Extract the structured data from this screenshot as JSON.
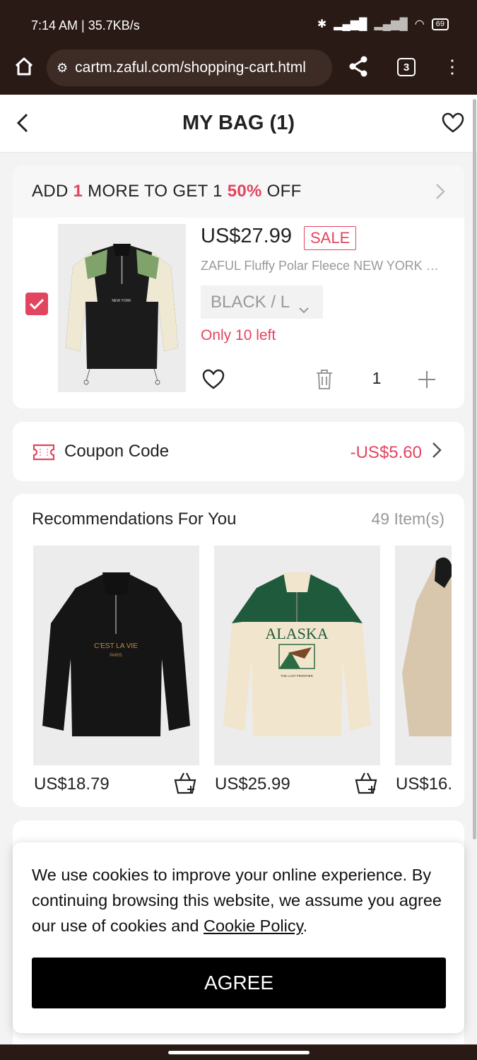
{
  "status_bar": {
    "time": "7:14 AM | 35.7KB/s",
    "battery": "69"
  },
  "browser": {
    "url": "cartm.zaful.com/shopping-cart.html",
    "tab_count": "3"
  },
  "header": {
    "title": "MY BAG (1)"
  },
  "promo": {
    "prefix": "ADD ",
    "count": "1",
    "middle": " MORE TO GET 1 ",
    "discount": "50%",
    "suffix": " OFF"
  },
  "cart_item": {
    "price": "US$27.99",
    "badge": "SALE",
    "name": "ZAFUL Fluffy Polar Fleece NEW YORK E...",
    "variant": "BLACK / L",
    "stock": "Only 10 left",
    "quantity": "1",
    "checked": true
  },
  "coupon": {
    "label": "Coupon Code",
    "amount": "-US$5.60"
  },
  "recommendations": {
    "title": "Recommendations For You",
    "count": "49 Item(s)",
    "items": [
      {
        "price": "US$18.79",
        "print": "C'EST LA VIE",
        "print2": "PARIS"
      },
      {
        "price": "US$25.99",
        "print": "ALASKA",
        "print2": "THE LAST FRONTIER"
      },
      {
        "price": "US$16."
      }
    ]
  },
  "cookie": {
    "text": "We use cookies to improve your online experience. By continuing browsing this website, we assume you agree our use of cookies and ",
    "link": "Cookie Policy",
    "end": ".",
    "button": "AGREE"
  },
  "colors": {
    "accent": "#e24560",
    "chrome": "#2a1a16"
  }
}
